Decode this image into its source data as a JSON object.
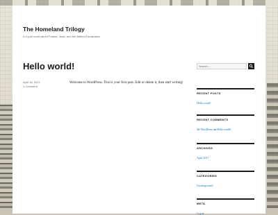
{
  "site": {
    "title": "The Homeland Trilogy",
    "description": "A 4-part novel about Poland, Jews, and the Balfour Declaration"
  },
  "post": {
    "title": "Hello world!",
    "date": "April 18, 2017",
    "comments": "1 Comment",
    "body": "Welcome to WordPress. This is your first post. Edit or delete it, then start writing!"
  },
  "sidebar": {
    "search": {
      "placeholder": "Search …"
    },
    "recent_posts": {
      "heading": "Recent Posts",
      "items": [
        "Hello world!"
      ]
    },
    "recent_comments": {
      "heading": "Recent Comments",
      "items": [
        {
          "author": "Mr WordPress",
          "connector": "on",
          "post": "Hello world!"
        }
      ]
    },
    "archives": {
      "heading": "Archives",
      "items": [
        "April 2017"
      ]
    },
    "categories": {
      "heading": "Categories",
      "items": [
        "Uncategorized"
      ]
    },
    "meta": {
      "heading": "Meta",
      "items": [
        "Log in"
      ]
    }
  },
  "colors": {
    "link": "#007acc",
    "text": "#1a1a1a",
    "muted": "#686868"
  },
  "icons": {
    "search_button": "search-icon"
  }
}
